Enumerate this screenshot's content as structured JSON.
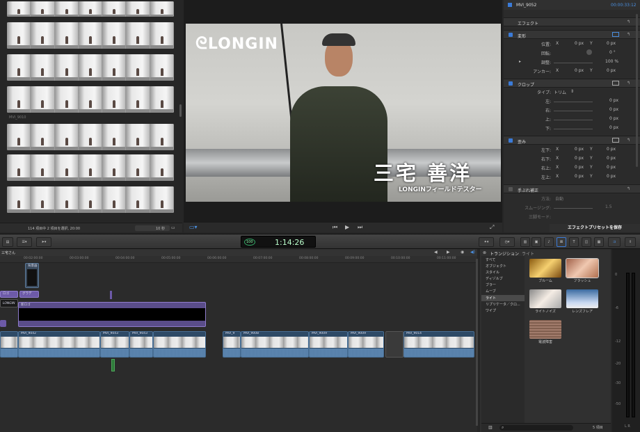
{
  "browser": {
    "clip_label": "MVI_9010",
    "status": "114 項目中 2 項目を選択, 20:00",
    "duration": "10 秒"
  },
  "viewer": {
    "overlay_logo": "LONGIN",
    "lower_third_name": "三宅 善洋",
    "lower_third_subtitle": "LONGINフィールドテスター"
  },
  "inspector": {
    "clip_name": "MVI_9052",
    "clip_duration": "00:00:33:12",
    "sections": {
      "effects": "エフェクト",
      "transform": "変形",
      "crop": "クロップ",
      "distort": "歪み",
      "stabilization": "手ぶれ補正"
    },
    "transform": {
      "position_label": "位置:",
      "rotation_label": "回転:",
      "scale_label": "調整:",
      "anchor_label": "アンカー:",
      "x": "X",
      "y": "Y",
      "zero_px": "0 px",
      "rotation_value": "0 °",
      "scale_value": "100 %"
    },
    "crop": {
      "type_label": "タイプ:",
      "type_value": "トリム",
      "left": "左:",
      "right": "右:",
      "top": "上:",
      "bottom": "下:",
      "value": "0 px"
    },
    "distort": {
      "bottom_left": "左下:",
      "bottom_right": "右下:",
      "top_right": "右上:",
      "top_left": "左上:",
      "x": "X",
      "y": "Y",
      "value": "0 px"
    },
    "stabilization": {
      "method_label": "方法:",
      "method_value": "自動",
      "smoothing_label": "スムージング:",
      "smoothing_value": "1.5",
      "tripod_label": "三脚モード:"
    },
    "save_preset": "エフェクトプリセットを保存"
  },
  "toolbar": {
    "timecode": "1:14:26",
    "percent": "100"
  },
  "timeline": {
    "project_title": "三宅さん",
    "ruler": [
      "00:02:00:00",
      "00:03:00:00",
      "00:04:00:00",
      "00:05:00:00",
      "00:06:00:00",
      "00:07:00:00",
      "00:08:00:00",
      "00:09:00:00",
      "00:10:00:00",
      "00:11:00:00"
    ],
    "title_clips": {
      "thumb_label": "背景画",
      "a": "ロゴ",
      "b": "グラデ",
      "c": "新ロゴ",
      "logo_text": "LONGIN"
    },
    "clips": [
      "MVI_9042",
      "MVI_9043",
      "MVI_9043",
      "MVI_9",
      "MVI_9008",
      "MVI_9009",
      "MVI_9009",
      "MVI_9014"
    ]
  },
  "transitions": {
    "title": "トランジション",
    "category": "ライト",
    "categories": [
      "すべて",
      "オブジェクト",
      "スタイル",
      "ディゾルブ",
      "ブラー",
      "ムーブ",
      "ライト",
      "リプリケータ／クロ...",
      "ワイプ"
    ],
    "selected_category": "ライト",
    "items": [
      "ブルーム",
      "フラッシュ",
      "ライトノイズ",
      "レンズフレア",
      "電波障害"
    ],
    "count": "5 項目"
  },
  "meters": {
    "labels": [
      "0",
      "-6",
      "-12",
      "-20",
      "-30",
      "-50"
    ],
    "channels": "L R"
  },
  "colors": {
    "accent": "#3b7bd8",
    "background": "#262626",
    "clip_blue": "#2e4a66",
    "title_purple": "#6d5aa8"
  }
}
